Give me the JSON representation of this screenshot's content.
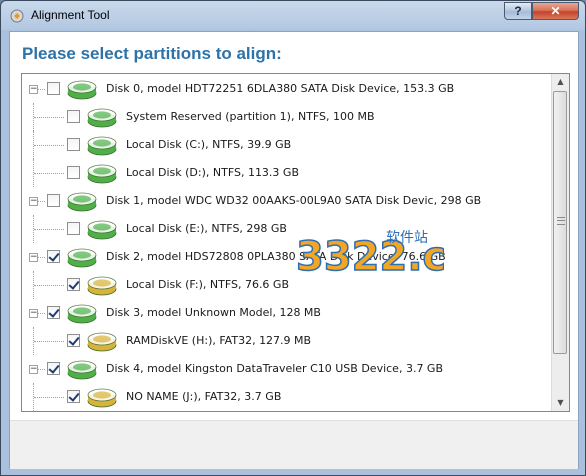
{
  "window": {
    "title": "Alignment Tool",
    "help_label": "?",
    "close_label": "✕"
  },
  "page": {
    "heading": "Please select partitions to align:"
  },
  "tree": {
    "rows": [
      {
        "kind": "disk",
        "checked": false,
        "icon": "green",
        "label": "Disk 0, model HDT72251 6DLA380 SATA Disk Device, 153.3 GB"
      },
      {
        "kind": "partition",
        "checked": false,
        "icon": "green",
        "label": "System Reserved (partition 1), NTFS, 100 MB"
      },
      {
        "kind": "partition",
        "checked": false,
        "icon": "green",
        "label": "Local Disk (C:), NTFS, 39.9 GB"
      },
      {
        "kind": "partition",
        "checked": false,
        "icon": "green",
        "label": "Local Disk (D:), NTFS, 113.3 GB"
      },
      {
        "kind": "disk",
        "checked": false,
        "icon": "green",
        "label": "Disk 1, model WDC WD32 00AAKS-00L9A0 SATA Disk Devic, 298 GB"
      },
      {
        "kind": "partition",
        "checked": false,
        "icon": "green",
        "label": "Local Disk (E:), NTFS, 298 GB"
      },
      {
        "kind": "disk",
        "checked": true,
        "icon": "green",
        "label": "Disk 2, model HDS72808 0PLA380 SATA Disk Device, 76.6 GB"
      },
      {
        "kind": "partition",
        "checked": true,
        "icon": "gold",
        "label": "Local Disk (F:), NTFS, 76.6 GB"
      },
      {
        "kind": "disk",
        "checked": true,
        "icon": "green",
        "label": "Disk 3, model Unknown Model, 128 MB"
      },
      {
        "kind": "partition",
        "checked": true,
        "icon": "gold",
        "label": "RAMDiskVE (H:), FAT32, 127.9 MB"
      },
      {
        "kind": "disk",
        "checked": true,
        "icon": "green",
        "label": "Disk 4, model Kingston DataTraveler C10 USB Device, 3.7 GB"
      },
      {
        "kind": "partition",
        "checked": true,
        "icon": "gold",
        "label": "NO NAME (J:), FAT32, 3.7 GB"
      }
    ],
    "expander_symbol": "−"
  },
  "scrollbar": {
    "up_arrow": "▲",
    "down_arrow": "▼"
  },
  "watermark": {
    "text": "3322.cc",
    "subtext": "软件站"
  },
  "colors": {
    "heading": "#2e73a8",
    "disk_green": "#4fb04a",
    "disk_gold": "#d9b23a"
  }
}
